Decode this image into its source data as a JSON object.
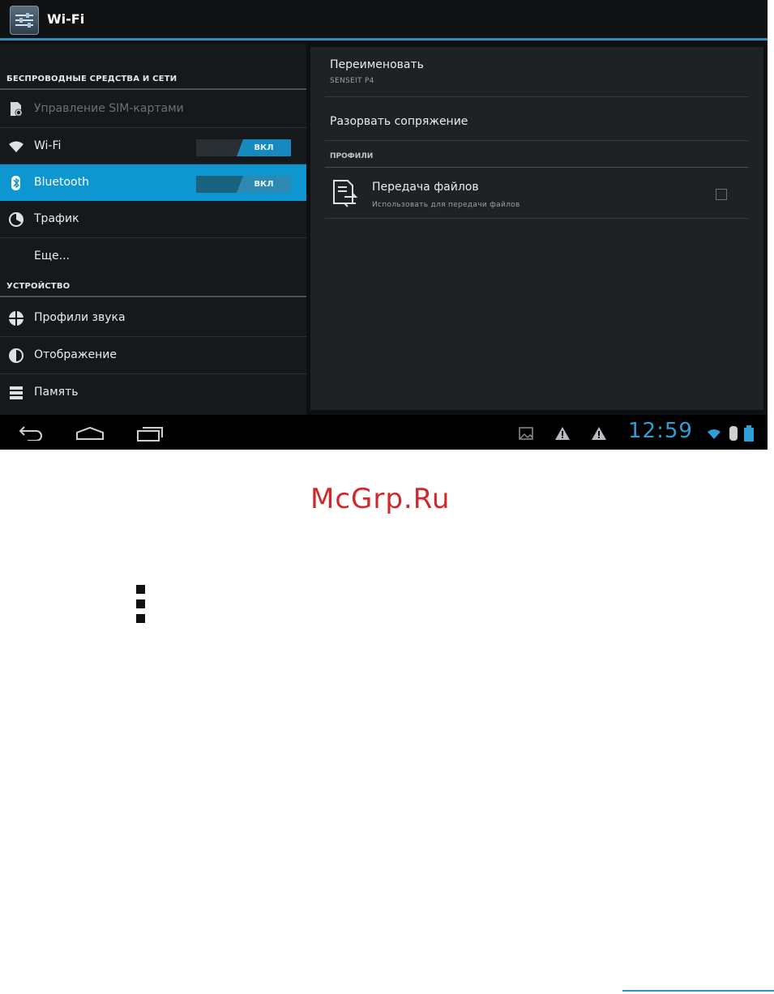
{
  "action_bar": {
    "title": "Wi-Fi",
    "icon": "settings-sliders-icon"
  },
  "left_panel": {
    "header_wireless": "БЕСПРОВОДНЫЕ СРЕДСТВА И СЕТИ",
    "items_wireless": [
      {
        "label": "Управление SIM-картами",
        "icon": "sim-card-icon",
        "disabled": true
      },
      {
        "label": "Wi-Fi",
        "icon": "wifi-icon",
        "toggle": "ВКЛ"
      },
      {
        "label": "Bluetooth",
        "icon": "bluetooth-icon",
        "toggle": "ВКЛ",
        "selected": true
      },
      {
        "label": "Трафик",
        "icon": "data-usage-icon"
      },
      {
        "label": "Еще..."
      }
    ],
    "header_device": "УСТРОЙСТВО",
    "items_device": [
      {
        "label": "Профили звука",
        "icon": "sound-icon"
      },
      {
        "label": "Отображение",
        "icon": "display-icon"
      },
      {
        "label": "Память",
        "icon": "storage-icon"
      }
    ]
  },
  "right_panel": {
    "rename_title": "Переименовать",
    "rename_sub": "SENSEIT P4",
    "unpair": "Разорвать сопряжение",
    "profiles_header": "ПРОФИЛИ",
    "file_transfer_title": "Передача файлов",
    "file_transfer_sub": "Использовать для передачи файлов",
    "file_transfer_checked": false
  },
  "nav_bar": {
    "time": "12:59"
  },
  "brand": "McGrp.Ru",
  "colors": {
    "accent": "#0e96d0",
    "clock": "#2e9ed6",
    "brand": "#d0272a"
  }
}
